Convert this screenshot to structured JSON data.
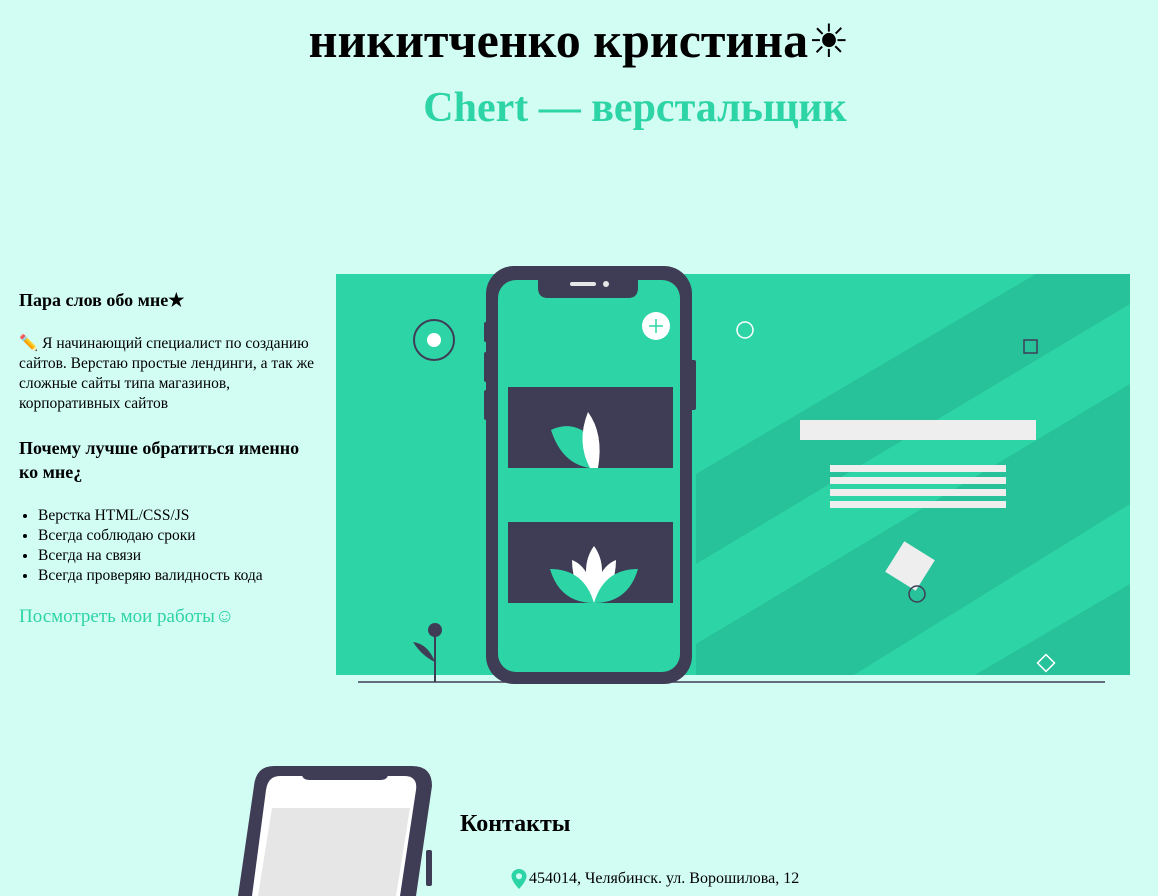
{
  "header": {
    "name": "никитченко кристина",
    "name_icon": "☀",
    "role": "Chert — верстальщик"
  },
  "about": {
    "heading1": "Пара слов обо мне★",
    "text": "✏️ Я начинающий специалист по созданию сайтов. Верстаю простые лендинги, а так же сложные сайты типа магазинов, корпоративных сайтов",
    "heading2": "Почему лучше обратиться именно ко мне¿",
    "list": [
      "Верстка HTML/CSS/JS",
      "Всегда соблюдаю сроки",
      "Всегда на связи",
      "Всегда проверяю валидность кода"
    ],
    "link": "Посмотреть мои работы☺"
  },
  "contacts": {
    "title": "Контакты",
    "address": "454014, Челябинск. ул. Ворошилова, 12"
  },
  "colors": {
    "background": "#d2fdf3",
    "accent": "#2dd4a6",
    "dark": "#3f3d56"
  }
}
